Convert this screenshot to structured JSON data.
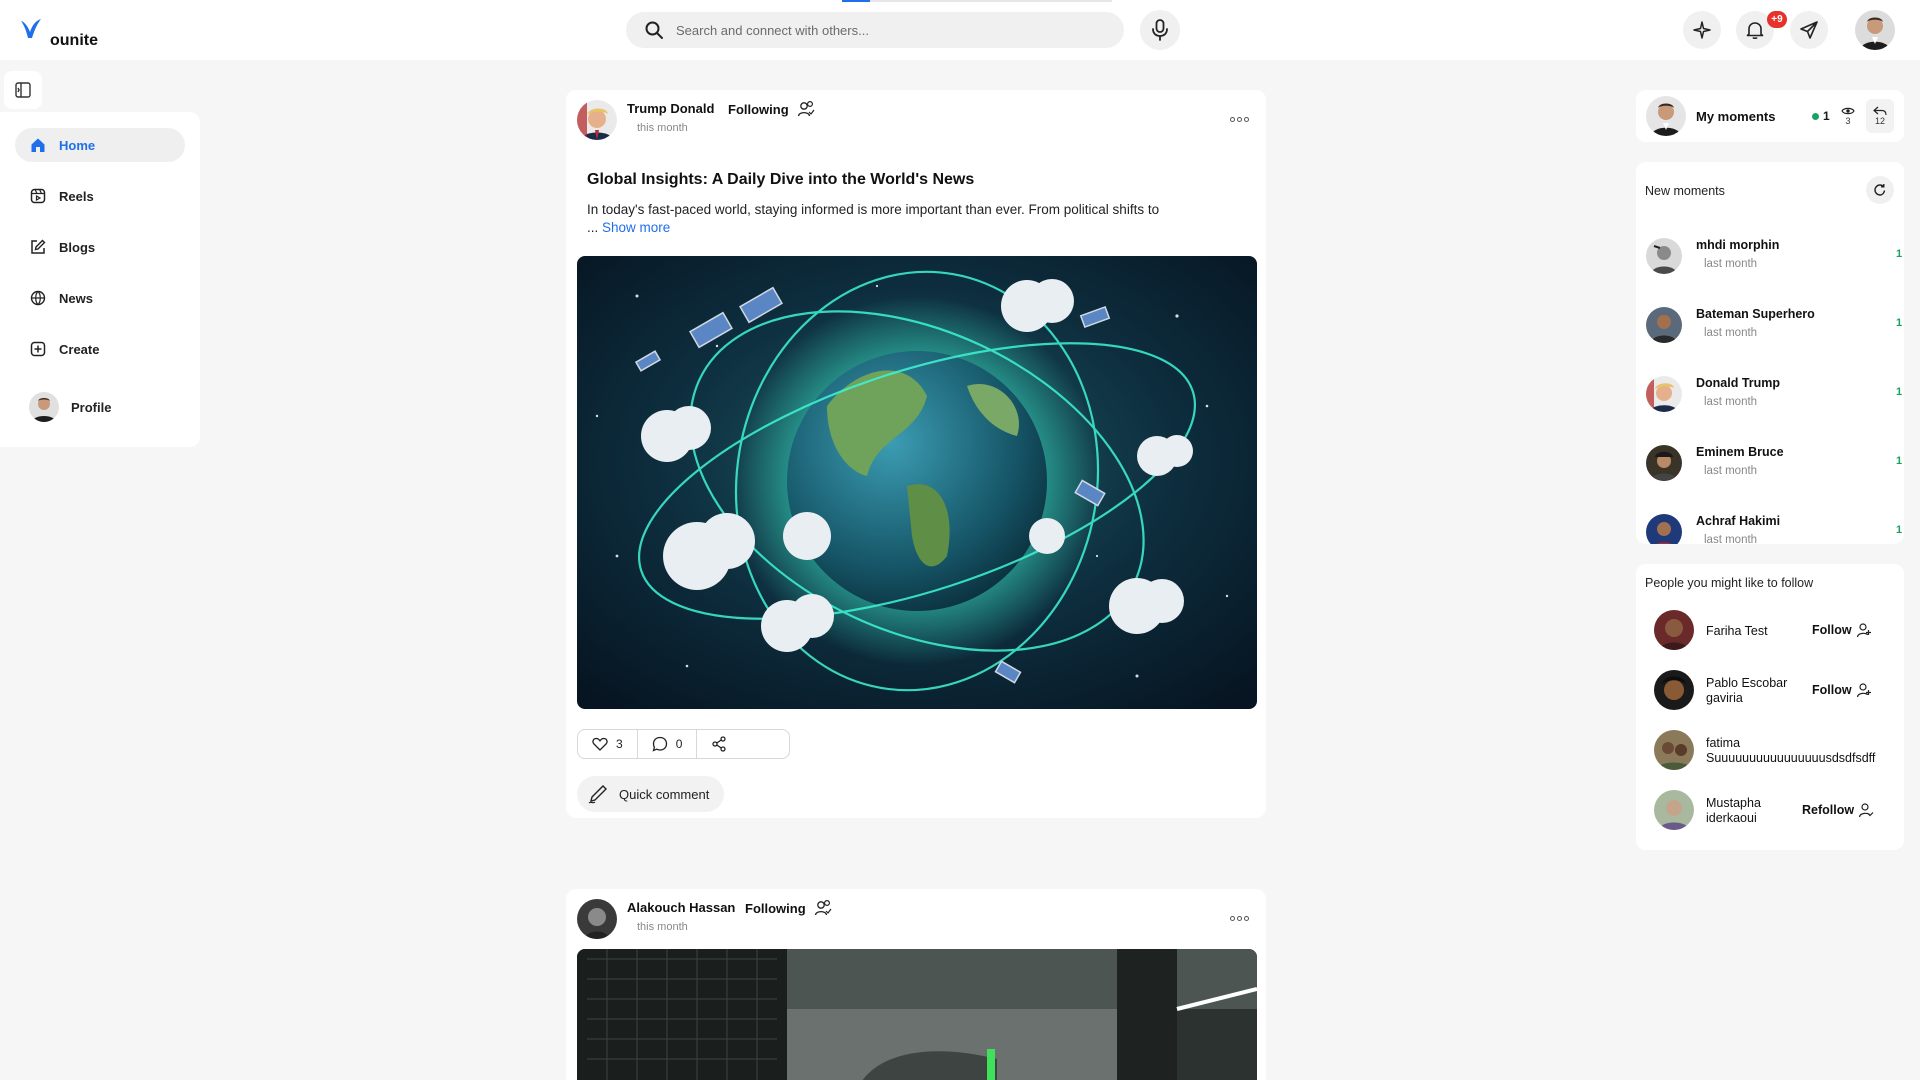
{
  "app": {
    "name": "ounite",
    "brand_color": "#1f6feb"
  },
  "search": {
    "placeholder": "Search and connect with others..."
  },
  "header": {
    "notification_badge": "+9"
  },
  "sidebar": {
    "items": [
      {
        "label": "Home",
        "icon": "home-icon",
        "active": true
      },
      {
        "label": "Reels",
        "icon": "reels-icon"
      },
      {
        "label": "Blogs",
        "icon": "blogs-icon"
      },
      {
        "label": "News",
        "icon": "news-icon"
      },
      {
        "label": "Create",
        "icon": "create-icon"
      },
      {
        "label": "Profile",
        "icon": "avatar"
      }
    ]
  },
  "posts": [
    {
      "author": "Trump Donald",
      "follow_state": "Following",
      "time": "this month",
      "title": "Global Insights: A Daily Dive into the World's News",
      "body": "In today's fast-paced world, staying informed is more important than ever. From political shifts to",
      "ellipsis": "...",
      "show_more": "Show more",
      "likes": "3",
      "comments": "0",
      "quick_comment": "Quick comment"
    },
    {
      "author": "Alakouch Hassan",
      "follow_state": "Following",
      "time": "this month"
    }
  ],
  "my_moments": {
    "label": "My moments",
    "count": "1",
    "views": "3",
    "replies": "12"
  },
  "new_moments": {
    "title": "New moments",
    "items": [
      {
        "name": "mhdi morphin",
        "time": "last month",
        "count": "1"
      },
      {
        "name": "Bateman Superhero",
        "time": "last month",
        "count": "1"
      },
      {
        "name": "Donald Trump",
        "time": "last month",
        "count": "1"
      },
      {
        "name": "Eminem Bruce",
        "time": "last month",
        "count": "1"
      },
      {
        "name": "Achraf Hakimi",
        "time": "last month",
        "count": "1"
      }
    ]
  },
  "suggestions": {
    "title": "People you might like to follow",
    "items": [
      {
        "name_line1": "Fariha Test",
        "name_line2": "",
        "action": "Follow"
      },
      {
        "name_line1": "Pablo Escobar",
        "name_line2": "gaviria",
        "action": "Follow"
      },
      {
        "name_line1": "fatima",
        "name_line2": "Suuuuuuuuuuuuuuuusdsdfsdff",
        "action": ""
      },
      {
        "name_line1": "Mustapha",
        "name_line2": "iderkaoui",
        "action": "Refollow"
      }
    ]
  }
}
